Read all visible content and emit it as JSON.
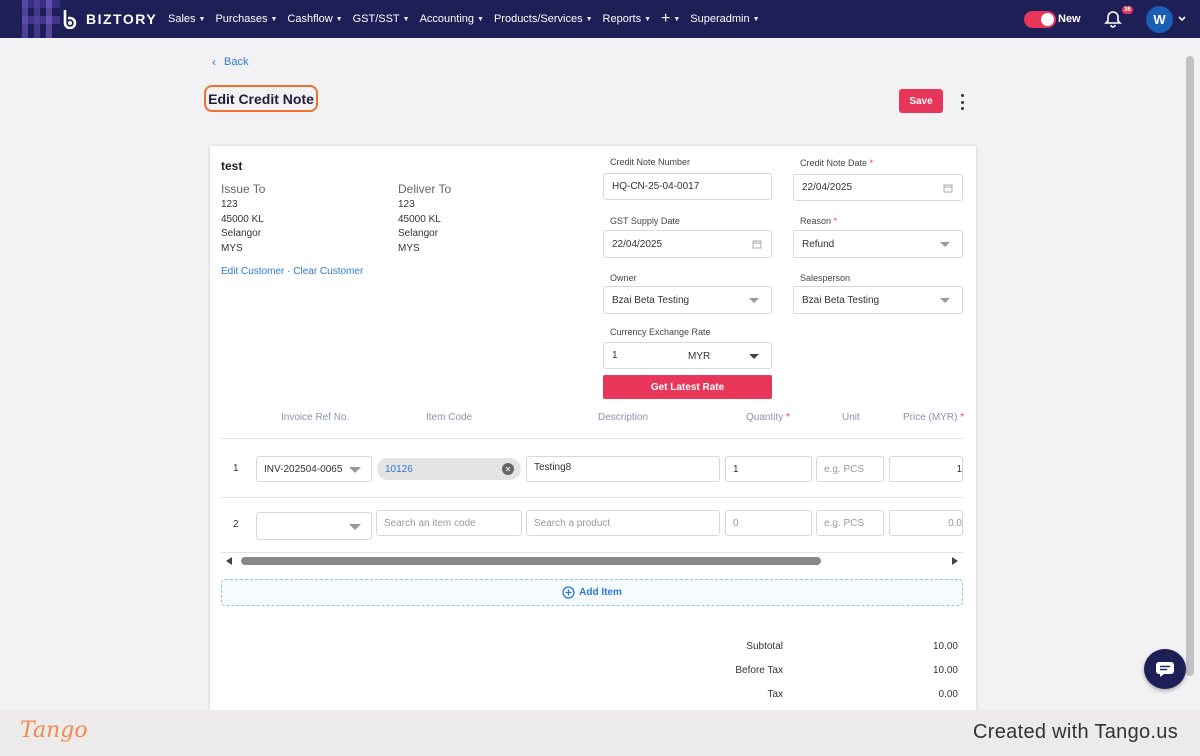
{
  "brand": {
    "name": "BIZTORY"
  },
  "nav": {
    "items": [
      {
        "label": "Sales",
        "has_caret": true
      },
      {
        "label": "Purchases",
        "has_caret": true
      },
      {
        "label": "Cashflow",
        "has_caret": true
      },
      {
        "label": "GST/SST",
        "has_caret": true
      },
      {
        "label": "Accounting",
        "has_caret": true
      },
      {
        "label": "Products/Services",
        "has_caret": true
      },
      {
        "label": "Reports",
        "has_caret": true
      },
      {
        "label": "+",
        "has_caret": true
      },
      {
        "label": "Superadmin",
        "has_caret": true
      }
    ]
  },
  "header": {
    "toggle_label": "New",
    "toggle_on": true,
    "notifications_count": "36",
    "avatar_initial": "W"
  },
  "page": {
    "back_label": "Back",
    "title": "Edit Credit Note",
    "save_label": "Save"
  },
  "customer": {
    "name": "test",
    "issue_to": {
      "title": "Issue To",
      "lines": [
        "123",
        "45000 KL",
        "Selangor",
        "MYS"
      ]
    },
    "deliver_to": {
      "title": "Deliver To",
      "lines": [
        "123",
        "45000 KL",
        "Selangor",
        "MYS"
      ]
    },
    "edit_link": "Edit Customer",
    "separator": " · ",
    "clear_link": "Clear Customer"
  },
  "form": {
    "credit_note_number": {
      "label": "Credit Note Number",
      "value": "HQ-CN-25-04-0017"
    },
    "credit_note_date": {
      "label": "Credit Note Date",
      "required": "*",
      "value": "22/04/2025"
    },
    "gst_supply_date": {
      "label": "GST Supply Date",
      "value": "22/04/2025"
    },
    "reason": {
      "label": "Reason",
      "required": "*",
      "value": "Refund"
    },
    "owner": {
      "label": "Owner",
      "value": "Bzai Beta Testing"
    },
    "salesperson": {
      "label": "Salesperson",
      "value": "Bzai Beta Testing"
    },
    "currency_rate": {
      "label": "Currency Exchange Rate",
      "value": "1",
      "currency": "MYR"
    },
    "get_rate_label": "Get Latest Rate"
  },
  "table": {
    "headers": {
      "invoice_ref": "Invoice Ref No.",
      "item_code": "Item Code",
      "description": "Description",
      "quantity": "Quantity",
      "quantity_req": "*",
      "unit": "Unit",
      "price": "Price (MYR)",
      "price_req": "*"
    },
    "rows": [
      {
        "num": "1",
        "invoice_ref": "INV-202504-0065",
        "item_code": "10126",
        "description": "Testing8",
        "quantity": "1",
        "unit_placeholder": "e.g. PCS",
        "price": "1"
      },
      {
        "num": "2",
        "invoice_ref": "",
        "item_code_placeholder": "Search an item code",
        "description_placeholder": "Search a product",
        "quantity_placeholder": "0",
        "unit_placeholder": "e.g. PCS",
        "price_placeholder": "0.0"
      }
    ],
    "add_item_label": "Add Item"
  },
  "totals": {
    "subtotal_label": "Subtotal",
    "subtotal": "10.00",
    "before_tax_label": "Before Tax",
    "before_tax": "10.00",
    "tax_label": "Tax",
    "tax": "0.00"
  },
  "footer": {
    "logo": "Tango",
    "credit": "Created with Tango.us"
  },
  "colors": {
    "topbar": "#1d1f56",
    "accent": "#e8355a",
    "link": "#2a7bd6",
    "highlight": "#f07030"
  }
}
